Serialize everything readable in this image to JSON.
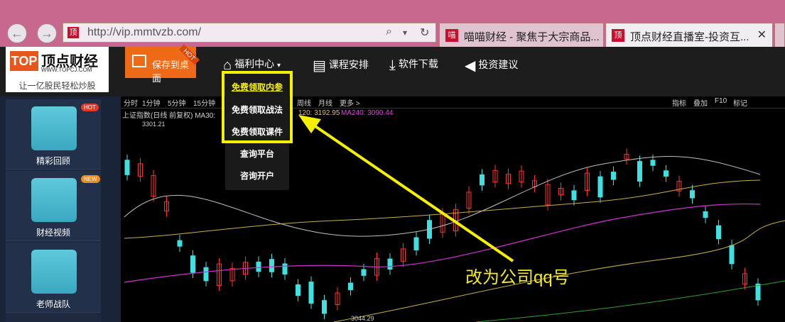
{
  "browser": {
    "back_glyph": "←",
    "forward_glyph": "→",
    "address_favicon": "顶",
    "url": "http://vip.mmtvzb.com/",
    "search_glyph": "⌕",
    "dropdown_glyph": "▾",
    "refresh_glyph": "↻",
    "tabs": [
      {
        "favicon": "喵",
        "title": "喵喵财经 - 聚焦于大宗商品..."
      },
      {
        "favicon": "顶",
        "title": "顶点财经直播室-投资互...",
        "close": "✕"
      }
    ]
  },
  "logo": {
    "mark": "TOP",
    "name": "顶点财经",
    "site": "WWW.TOPCJ.COM",
    "slogan": "让一亿股民轻松炒股"
  },
  "header": {
    "save_label": "保存到桌面",
    "hot": "HOT",
    "nav": [
      {
        "label": "福利中心",
        "icon": "home-icon",
        "glyph": "⌂",
        "caret": "▾"
      },
      {
        "label": "课程安排",
        "icon": "book-icon",
        "glyph": "▤"
      },
      {
        "label": "软件下载",
        "icon": "download-icon",
        "glyph": "⤓"
      },
      {
        "label": "投资建议",
        "icon": "speaker-icon",
        "glyph": "◀"
      }
    ]
  },
  "dropdown": {
    "items": [
      "免费领取内参",
      "免费领取战法",
      "免费领取课件",
      "查询平台",
      "咨询开户"
    ],
    "highlight_color": "#f5f000"
  },
  "sidebar": {
    "items": [
      {
        "label": "精彩回顾",
        "badge": "HOT",
        "icon": "clapperboard-icon"
      },
      {
        "label": "财经视频",
        "badge": "NEW",
        "icon": "vinyl-record-icon"
      },
      {
        "label": "老师战队",
        "icon": "person-icon"
      }
    ]
  },
  "chart_toolbar": {
    "left": [
      "分时",
      "1分钟",
      "5分钟",
      "15分钟",
      "周线",
      "月线",
      "更多 >"
    ],
    "right": [
      "指标",
      "叠加",
      "F10",
      "标记"
    ],
    "ma_title": "上证指数(日线 前复权) MA30:",
    "ma120": "120: 3192.95",
    "ma240": "MA240: 3090.44",
    "high_label": "3301.21",
    "low_label": "3044.29"
  },
  "annotation": {
    "text": "改为公司qq号",
    "color": "#f2ec1a"
  },
  "chart_data": {
    "type": "candlestick",
    "title": "上证指数(日线 前复权)",
    "annotations": [
      "3301.21",
      "3044.29"
    ],
    "series": [
      {
        "name": "MA120",
        "value": 3192.95
      },
      {
        "name": "MA240",
        "value": 3090.44
      }
    ]
  }
}
